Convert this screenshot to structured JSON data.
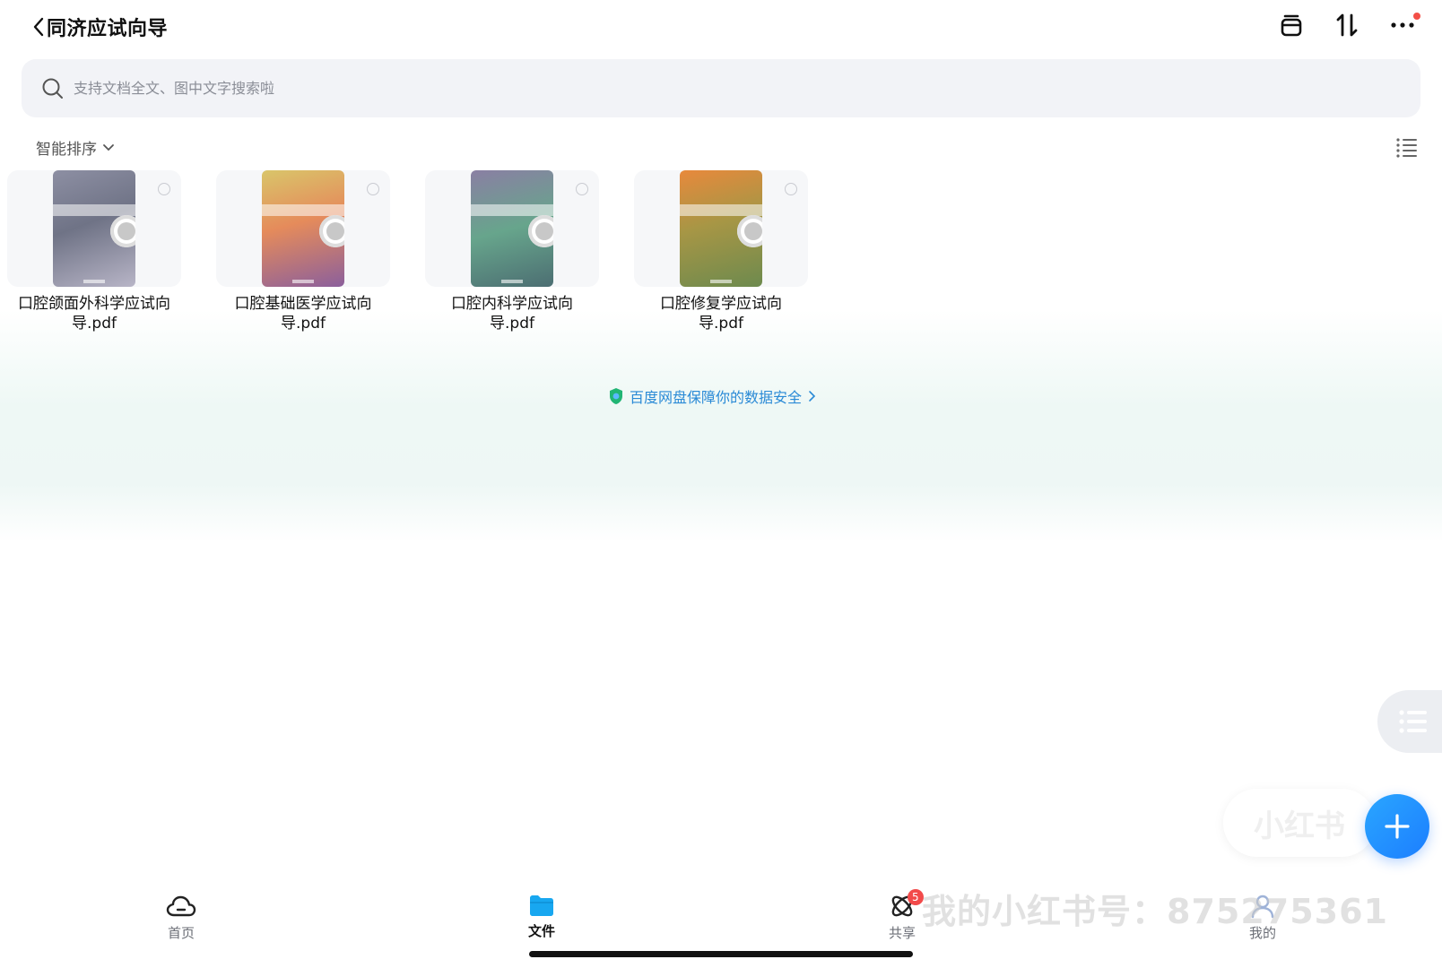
{
  "header": {
    "title": "同济应试向导",
    "actions": [
      "archive-icon",
      "sort-transfer-icon",
      "more-icon"
    ]
  },
  "search": {
    "placeholder": "支持文档全文、图中文字搜索啦"
  },
  "sort": {
    "label": "智能排序"
  },
  "files": [
    {
      "name": "口腔颌面外科学应试向导.pdf",
      "cover_color": "#6f7386",
      "cover_accent": "#b8b5c7"
    },
    {
      "name": "口腔基础医学应试向导.pdf",
      "cover_color": "#e58b5b",
      "cover_accent": "#8b5f9c"
    },
    {
      "name": "口腔内科学应试向导.pdf",
      "cover_color": "#67a58c",
      "cover_accent": "#8a7fa3"
    },
    {
      "name": "口腔修复学应试向导.pdf",
      "cover_color": "#6d8a4e",
      "cover_accent": "#e8893c"
    }
  ],
  "security_notice": {
    "text": "百度网盘保障你的数据安全"
  },
  "tabs": [
    {
      "label": "首页",
      "icon": "cloud-icon",
      "active": false
    },
    {
      "label": "文件",
      "icon": "folder-icon",
      "active": true
    },
    {
      "label": "共享",
      "icon": "share-icon",
      "active": false,
      "badge": "5"
    },
    {
      "label": "我的",
      "icon": "profile-icon",
      "active": false
    }
  ],
  "watermark": {
    "pill": "小红书",
    "text": "我的小红书号：875275361"
  },
  "colors": {
    "accent": "#1c7eff",
    "link": "#2a8ad6",
    "badge": "#f24a4a"
  }
}
